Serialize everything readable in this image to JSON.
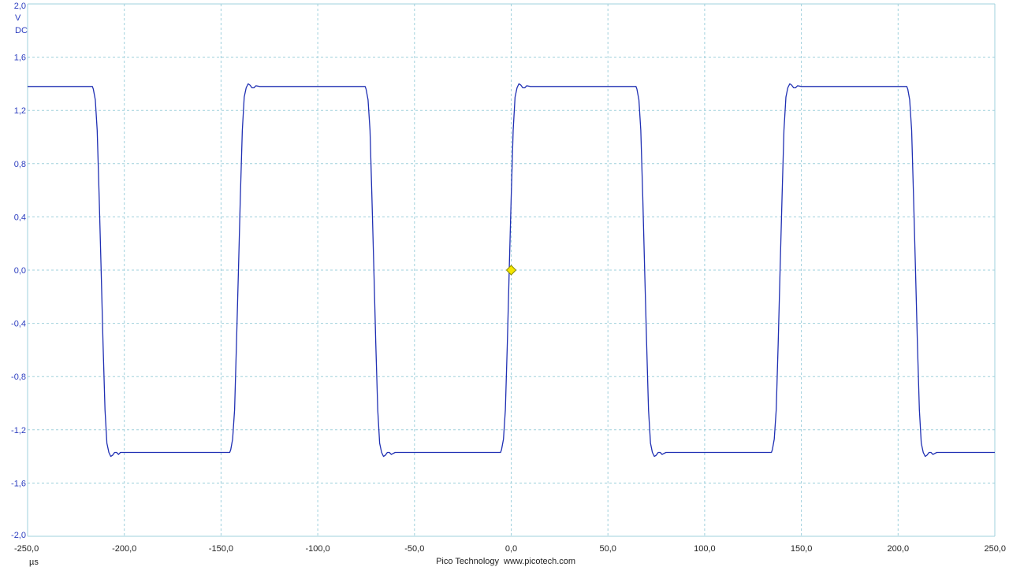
{
  "app": {
    "vendor_label": "Pico Technology",
    "website_label": "www.picotech.com"
  },
  "colors": {
    "trace": "#1f2fb3",
    "grid": "#9fd0dc",
    "axis_text_y": "#2b3dbf",
    "axis_text_x": "#222222",
    "trigger_marker_fill": "#f5e600",
    "trigger_marker_stroke": "#8a8a00",
    "background": "#ffffff"
  },
  "chart_data": {
    "type": "line",
    "title": "",
    "y_unit": "V",
    "coupling": "DC",
    "x_unit": "µs",
    "xlim": [
      -250,
      250
    ],
    "ylim": [
      -2.0,
      2.0
    ],
    "grid": true,
    "x_tick_values": [
      -250,
      -200,
      -150,
      -100,
      -50,
      0,
      50,
      100,
      150,
      200,
      250
    ],
    "x_tick_labels": [
      "-250,0",
      "-200,0",
      "-150,0",
      "-100,0",
      "-50,0",
      "0,0",
      "50,0",
      "100,0",
      "150,0",
      "200,0",
      "250,0"
    ],
    "y_tick_values": [
      2.0,
      1.6,
      1.2,
      0.8,
      0.4,
      0.0,
      -0.4,
      -0.8,
      -1.2,
      -1.6,
      -2.0
    ],
    "y_tick_labels": [
      "2,0",
      "1,6",
      "1,2",
      "0,8",
      "0,4",
      "0,0",
      "-0,4",
      "-0,8",
      "-1,2",
      "-1,6",
      "-2,0"
    ],
    "series": [
      {
        "x": [
          -250,
          -216.5,
          -216,
          -215,
          -214,
          -213,
          -212,
          -211,
          -210,
          -209,
          -208,
          -207,
          -206,
          -205,
          -204,
          -203,
          -202,
          -200,
          -180,
          -145.5,
          -145,
          -144,
          -143,
          -142,
          -141,
          -140,
          -139,
          -138,
          -137,
          -136,
          -135,
          -134,
          -133,
          -132,
          -130,
          -110,
          -75.5,
          -75,
          -74,
          -73,
          -72,
          -71,
          -70,
          -69,
          -68,
          -67,
          -66,
          -65,
          -64,
          -63,
          -62,
          -60,
          -40,
          -5.5,
          -5,
          -4,
          -3,
          -2,
          -1,
          0,
          1,
          2,
          3,
          4,
          5,
          6,
          7,
          8,
          10,
          30,
          64.5,
          65,
          66,
          67,
          68,
          69,
          70,
          71,
          72,
          73,
          74,
          75,
          76,
          77,
          78,
          80,
          100,
          134.5,
          135,
          136,
          137,
          138,
          139,
          140,
          141,
          142,
          143,
          144,
          145,
          146,
          147,
          148,
          150,
          170,
          204.5,
          205,
          206,
          207,
          208,
          209,
          210,
          211,
          212,
          213,
          214,
          215,
          216,
          217,
          218,
          220,
          250
        ],
        "y": [
          1.38,
          1.38,
          1.36,
          1.28,
          1.05,
          0.55,
          0.0,
          -0.55,
          -1.05,
          -1.3,
          -1.37,
          -1.4,
          -1.39,
          -1.37,
          -1.37,
          -1.385,
          -1.37,
          -1.37,
          -1.37,
          -1.37,
          -1.35,
          -1.27,
          -1.05,
          -0.55,
          0.0,
          0.55,
          1.05,
          1.3,
          1.37,
          1.4,
          1.39,
          1.37,
          1.37,
          1.385,
          1.38,
          1.38,
          1.38,
          1.36,
          1.28,
          1.05,
          0.55,
          0.0,
          -0.55,
          -1.05,
          -1.3,
          -1.37,
          -1.4,
          -1.39,
          -1.37,
          -1.37,
          -1.385,
          -1.37,
          -1.37,
          -1.37,
          -1.35,
          -1.27,
          -1.05,
          -0.55,
          0.0,
          0.55,
          1.05,
          1.3,
          1.37,
          1.4,
          1.39,
          1.37,
          1.37,
          1.385,
          1.38,
          1.38,
          1.38,
          1.36,
          1.28,
          1.05,
          0.55,
          0.0,
          -0.55,
          -1.05,
          -1.3,
          -1.37,
          -1.4,
          -1.39,
          -1.37,
          -1.37,
          -1.385,
          -1.37,
          -1.37,
          -1.37,
          -1.35,
          -1.27,
          -1.05,
          -0.55,
          0.0,
          0.55,
          1.05,
          1.3,
          1.37,
          1.4,
          1.39,
          1.37,
          1.37,
          1.385,
          1.38,
          1.38,
          1.38,
          1.36,
          1.28,
          1.05,
          0.55,
          0.0,
          -0.55,
          -1.05,
          -1.3,
          -1.37,
          -1.4,
          -1.39,
          -1.37,
          -1.37,
          -1.385,
          -1.37,
          -1.37
        ]
      }
    ],
    "trigger_marker": {
      "x": 0,
      "y": 0.0
    }
  }
}
